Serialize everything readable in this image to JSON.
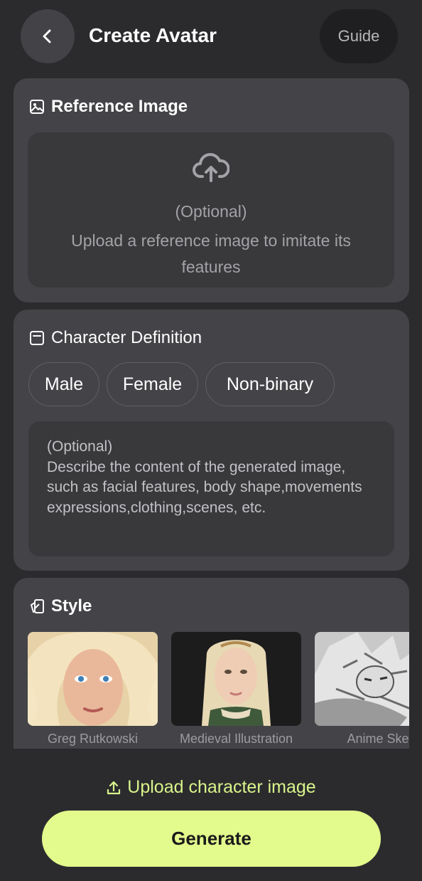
{
  "header": {
    "title": "Create Avatar",
    "guide_label": "Guide"
  },
  "reference": {
    "title": "Reference Image",
    "optional": "(Optional)",
    "description": "Upload a reference image to imitate its features"
  },
  "character": {
    "title": "Character Definition",
    "genders": [
      "Male",
      "Female",
      "Non-binary"
    ],
    "placeholder": "(Optional)\nDescribe the content of the generated image, such as facial features, body shape,movements expressions,clothing,scenes, etc."
  },
  "style": {
    "title": "Style",
    "items": [
      {
        "label": "Greg Rutkowski"
      },
      {
        "label": "Medieval Illustration"
      },
      {
        "label": "Anime Sket"
      }
    ]
  },
  "footer": {
    "upload_label": "Upload character image",
    "generate_label": "Generate"
  },
  "colors": {
    "accent": "#e2fb8c",
    "accent_text": "#d9f48a",
    "background": "#2b2b2e",
    "card": "#444448"
  }
}
